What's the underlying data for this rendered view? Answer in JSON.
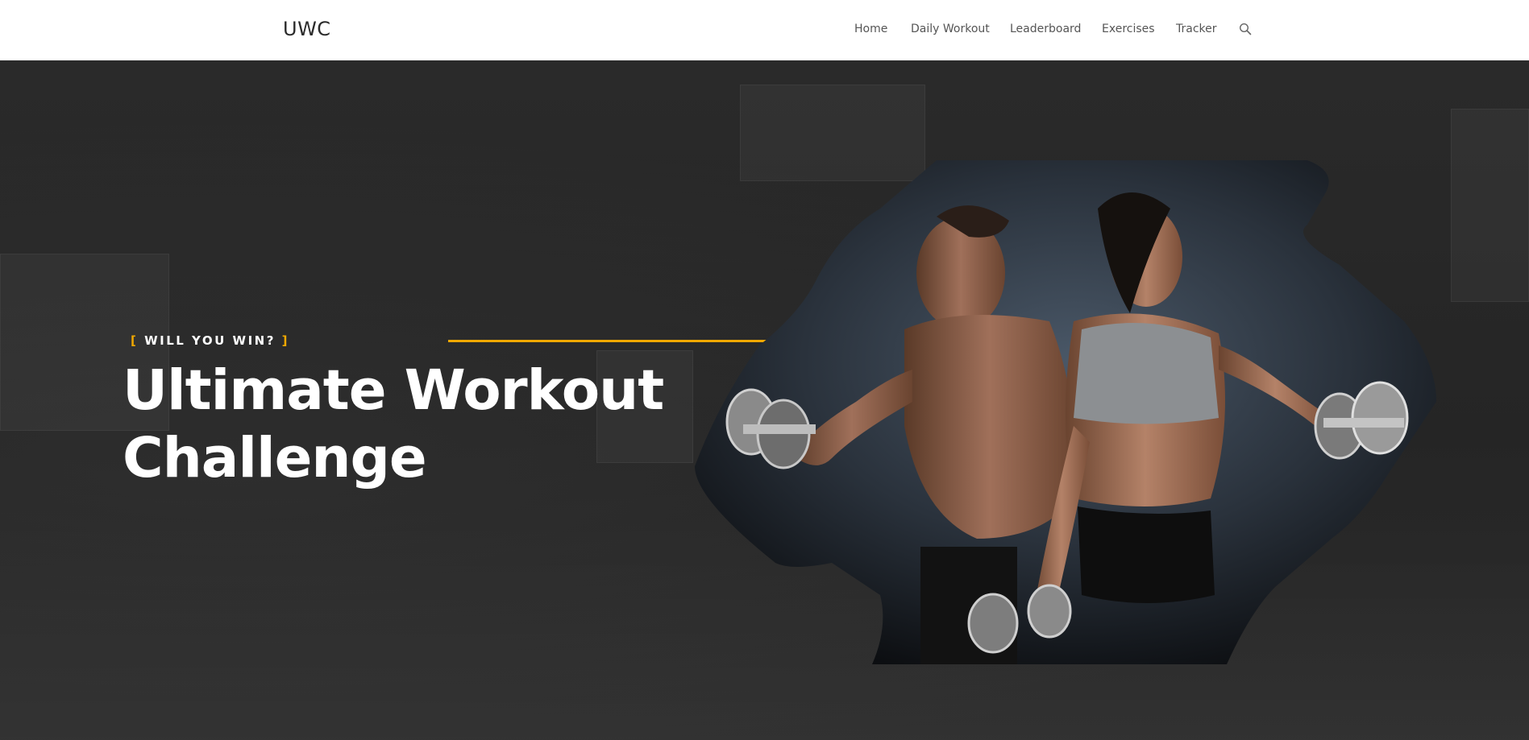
{
  "header": {
    "logo": "UWC",
    "nav": [
      {
        "label": "Home"
      },
      {
        "label": "Daily Workout"
      },
      {
        "label": "Leaderboard"
      },
      {
        "label": "Exercises"
      },
      {
        "label": "Tracker"
      }
    ],
    "search_icon": "search-icon"
  },
  "hero": {
    "tagline_open": "[",
    "tagline": "WILL YOU WIN?",
    "tagline_close": "]",
    "title_line1": "Ultimate Workout",
    "title_line2": "Challenge",
    "image": "fitness-couple-with-dumbbells"
  },
  "colors": {
    "accent": "#f0a800",
    "header_bg": "#ffffff",
    "hero_bg": "#262626",
    "title": "#ffffff",
    "nav_text": "#555555"
  }
}
